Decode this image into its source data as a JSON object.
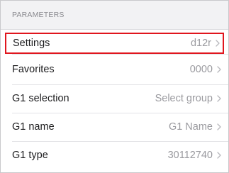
{
  "section": {
    "title": "PARAMETERS"
  },
  "rows": [
    {
      "label": "Settings",
      "value": "d12r",
      "highlighted": true
    },
    {
      "label": "Favorites",
      "value": "0000"
    },
    {
      "label": "G1 selection",
      "value": "Select group"
    },
    {
      "label": "G1 name",
      "value": "G1 Name"
    },
    {
      "label": "G1 type",
      "value": "30112740"
    }
  ],
  "colors": {
    "highlight_border": "#e0161e",
    "header_background": "#f2f2f4",
    "value_text": "#9a9a9f"
  },
  "icons": {
    "row_disclosure": "chevron-right-icon"
  }
}
